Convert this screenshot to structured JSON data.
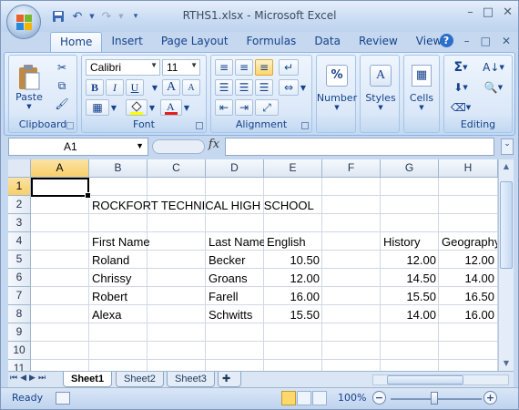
{
  "window": {
    "title": "RTHS1.xlsx - Microsoft Excel",
    "controls": [
      "–",
      "□",
      "✕"
    ],
    "doc_controls": [
      "–",
      "□",
      "✕"
    ]
  },
  "qat": {
    "save_icon": "save-icon",
    "undo_icon": "undo-icon",
    "redo_icon": "redo-icon"
  },
  "tabs": [
    "Home",
    "Insert",
    "Page Layout",
    "Formulas",
    "Data",
    "Review",
    "View"
  ],
  "active_tab": "Home",
  "ribbon": {
    "clipboard": {
      "label": "Clipboard",
      "paste": "Paste"
    },
    "font": {
      "label": "Font",
      "name": "Calibri",
      "size": "11",
      "bold": "B",
      "italic": "I",
      "underline": "U",
      "grow": "A",
      "shrink": "A"
    },
    "alignment": {
      "label": "Alignment"
    },
    "number": {
      "label": "Number",
      "symbol": "%"
    },
    "styles": {
      "label": "Styles"
    },
    "cells": {
      "label": "Cells"
    },
    "editing": {
      "label": "Editing",
      "sum": "Σ"
    }
  },
  "formula_bar": {
    "name_box": "A1",
    "fx": "fx",
    "value": ""
  },
  "grid": {
    "columns": [
      "A",
      "B",
      "C",
      "D",
      "E",
      "F",
      "G",
      "H"
    ],
    "rows": [
      "1",
      "2",
      "3",
      "4",
      "5",
      "6",
      "7",
      "8",
      "9",
      "10",
      "11"
    ],
    "selected_column": "A",
    "selected_row": "1",
    "cells": {
      "B2": "ROCKFORT TECHNICAL HIGH SCHOOL",
      "B4": "First Name",
      "D4": "Last Name",
      "E4": "English",
      "G4": "History",
      "H4": "Geography",
      "B5": "Roland",
      "D5": "Becker",
      "E5": "10.50",
      "G5": "12.00",
      "H5": "12.00",
      "B6": "Chrissy",
      "D6": "Groans",
      "E6": "12.00",
      "G6": "14.50",
      "H6": "14.00",
      "B7": "Robert",
      "D7": "Farell",
      "E7": "16.00",
      "G7": "15.50",
      "H7": "16.50",
      "B8": "Alexa",
      "D8": "Schwitts",
      "E8": "15.50",
      "G8": "14.00",
      "H8": "16.00"
    }
  },
  "sheets": [
    "Sheet1",
    "Sheet2",
    "Sheet3"
  ],
  "active_sheet": "Sheet1",
  "status": {
    "ready": "Ready",
    "zoom": "100%"
  },
  "colors": {
    "frame": "#c5d8ef",
    "accent": "#15428b",
    "selection": "#f8cf6a"
  }
}
